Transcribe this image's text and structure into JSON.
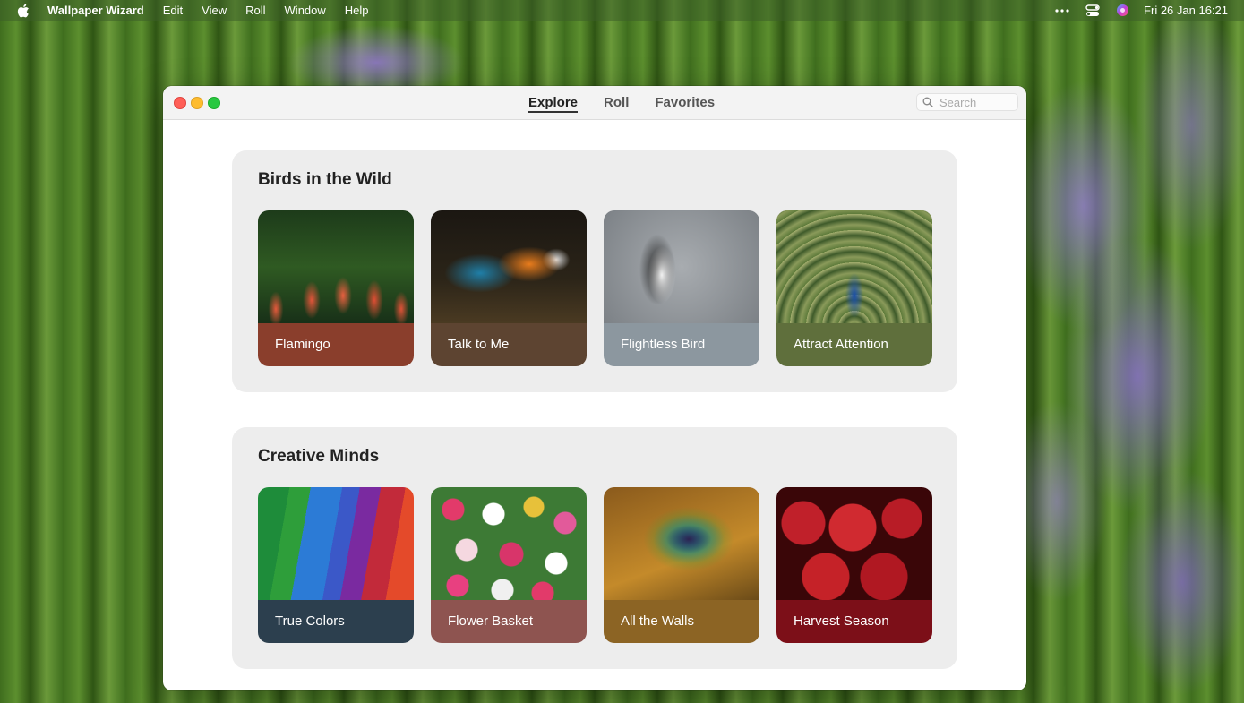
{
  "menubar": {
    "apple_icon": "apple-icon",
    "app_name": "Wallpaper Wizard",
    "items": [
      "Edit",
      "View",
      "Roll",
      "Window",
      "Help"
    ],
    "status_icons": [
      "ellipsis-icon",
      "control-center-icon",
      "siri-icon"
    ],
    "clock": "Fri 26 Jan  16:21"
  },
  "window": {
    "tabs": [
      {
        "label": "Explore",
        "active": true
      },
      {
        "label": "Roll",
        "active": false
      },
      {
        "label": "Favorites",
        "active": false
      }
    ],
    "search": {
      "placeholder": "Search",
      "value": ""
    }
  },
  "sections": [
    {
      "title": "Birds in the Wild",
      "cards": [
        {
          "label": "Flamingo",
          "color": "#8a3e2c",
          "image": "flamingos"
        },
        {
          "label": "Talk to Me",
          "color": "#5d4431",
          "image": "macaw parrot"
        },
        {
          "label": "Flightless Bird",
          "color": "#8c979f",
          "image": "penguin on gravel"
        },
        {
          "label": "Attract Attention",
          "color": "#5f6f3c",
          "image": "peacock"
        }
      ]
    },
    {
      "title": "Creative Minds",
      "cards": [
        {
          "label": "True Colors",
          "color": "#2c3f4e",
          "image": "colored pencils"
        },
        {
          "label": "Flower Basket",
          "color": "#8e5450",
          "image": "tulips"
        },
        {
          "label": "All the Walls",
          "color": "#8c6424",
          "image": "peacock feather"
        },
        {
          "label": "Harvest Season",
          "color": "#7c0f18",
          "image": "cherries"
        }
      ]
    }
  ]
}
